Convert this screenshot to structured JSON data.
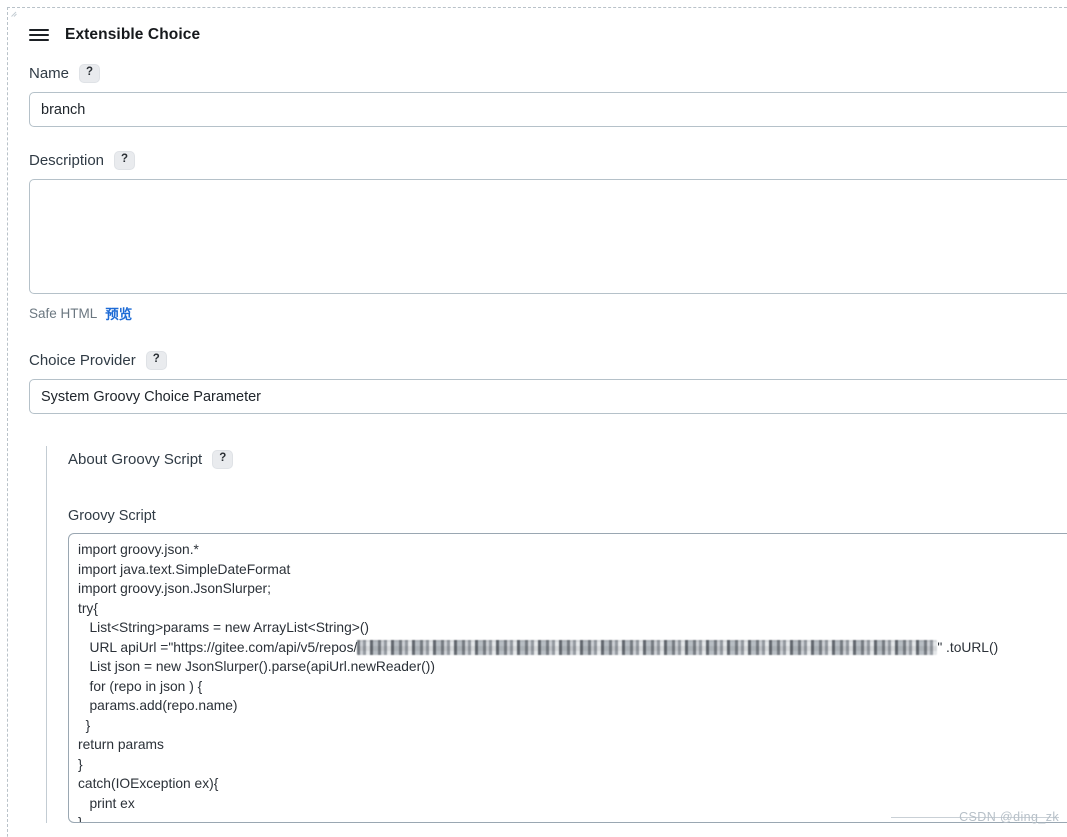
{
  "block": {
    "title": "Extensible Choice",
    "drag_icon": "drag-handle-icon",
    "menu_icon": "hamburger-icon"
  },
  "fields": {
    "name": {
      "label": "Name",
      "help": "?",
      "value": "branch",
      "placeholder": ""
    },
    "description": {
      "label": "Description",
      "help": "?",
      "value": "",
      "placeholder": "",
      "safe_html_label": "Safe HTML",
      "preview_link": "预览"
    },
    "choice_provider": {
      "label": "Choice Provider",
      "help": "?",
      "value": "System Groovy Choice Parameter",
      "options": [
        "System Groovy Choice Parameter"
      ]
    }
  },
  "groovy": {
    "about_label": "About Groovy Script",
    "about_help": "?",
    "script_label": "Groovy Script",
    "script_lines": [
      "import groovy.json.*",
      "import java.text.SimpleDateFormat",
      "import groovy.json.JsonSlurper;",
      "try{",
      "   List<String>params = new ArrayList<String>()",
      "   URL apiUrl =\"https://gitee.com/api/v5/repos/",
      "   List json = new JsonSlurper().parse(apiUrl.newReader())",
      "   for (repo in json ) {",
      "   params.add(repo.name)",
      "  }",
      "return params",
      "}",
      "catch(IOException ex){",
      "   print ex",
      "}"
    ],
    "redacted_note": "redacted-url-segment",
    "url_line_suffix": "\" .toURL()"
  },
  "watermark": "CSDN @ding_zk",
  "colors": {
    "link": "#1e6bd6",
    "border": "#b5c1c9",
    "text": "#303b45",
    "dashed_border": "#b9c2c9"
  }
}
